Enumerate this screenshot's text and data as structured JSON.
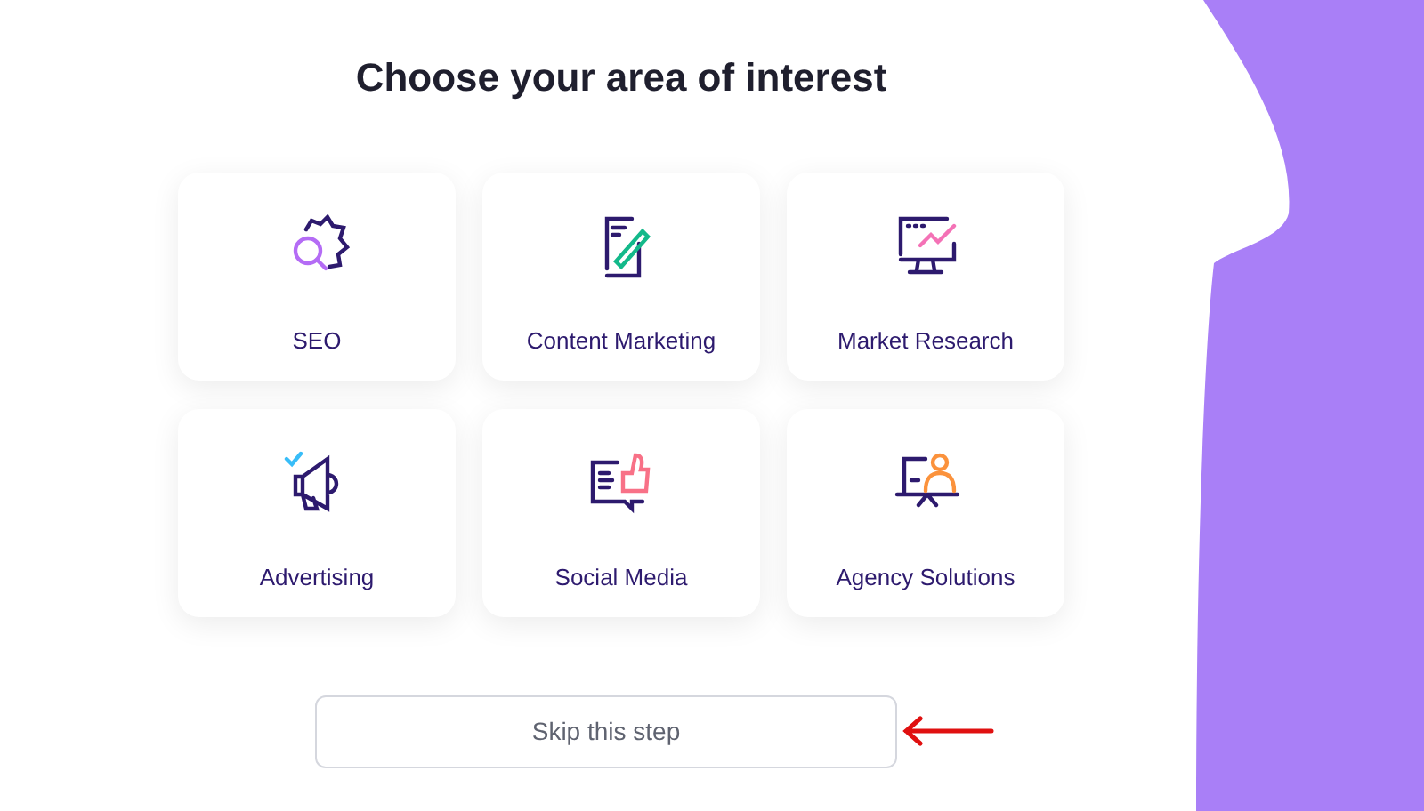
{
  "title": "Choose your area of interest",
  "options": [
    {
      "label": "SEO"
    },
    {
      "label": "Content Marketing"
    },
    {
      "label": "Market Research"
    },
    {
      "label": "Advertising"
    },
    {
      "label": "Social Media"
    },
    {
      "label": "Agency Solutions"
    }
  ],
  "skip_button": "Skip this step"
}
